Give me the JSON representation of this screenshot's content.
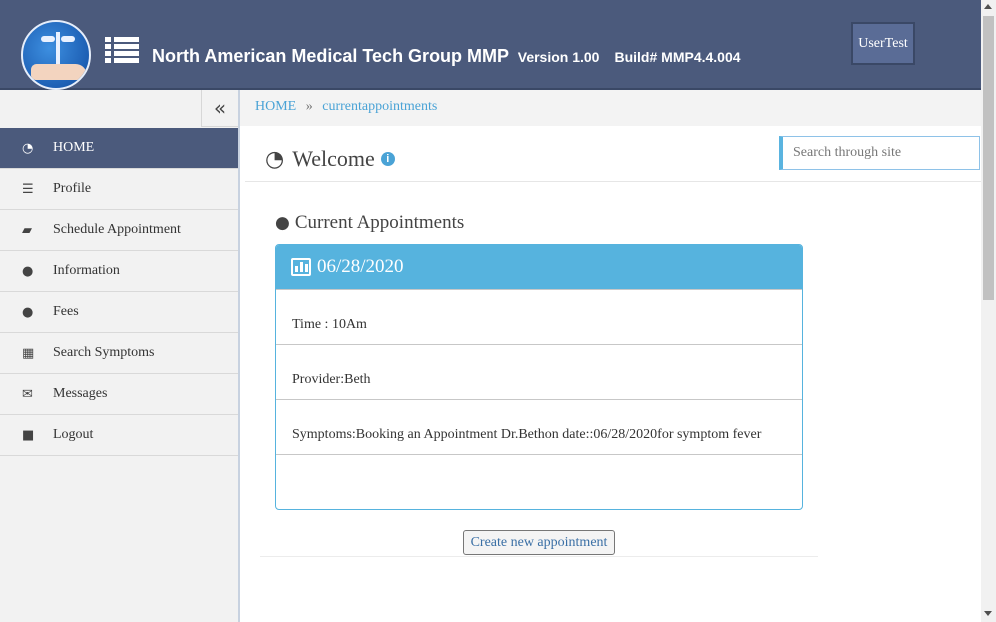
{
  "header": {
    "app_name": "North American Medical Tech Group MMP",
    "version": "Version 1.00",
    "build": "Build# MMP4.4.004",
    "user": "UserTest"
  },
  "sidebar": {
    "collapse_icon": "double-chevron-left-icon",
    "items": [
      {
        "label": "HOME",
        "icon": "dashboard-icon",
        "active": true
      },
      {
        "label": "Profile",
        "icon": "list-indent-icon"
      },
      {
        "label": "Schedule Appointment",
        "icon": "book-icon"
      },
      {
        "label": "Information",
        "icon": "drop-icon"
      },
      {
        "label": "Fees",
        "icon": "user-icon"
      },
      {
        "label": "Search Symptoms",
        "icon": "table-icon"
      },
      {
        "label": "Messages",
        "icon": "envelope-icon"
      },
      {
        "label": "Logout",
        "icon": "lock-icon"
      }
    ]
  },
  "breadcrumb": {
    "home": "HOME",
    "separator": "»",
    "current": "currentappointments"
  },
  "page": {
    "title": "Welcome",
    "search_placeholder": "Search through site"
  },
  "appointments": {
    "section_title": "Current Appointments",
    "card": {
      "date": "06/28/2020",
      "time": "Time : 10Am",
      "provider": "Provider:Beth",
      "symptoms": "Symptoms:Booking an Appointment Dr.Bethon date::06/28/2020for symptom fever"
    },
    "create_button": "Create new appointment"
  },
  "colors": {
    "header_bg": "#4b5a7c",
    "accent": "#56b3de",
    "link": "#4aa3d6"
  }
}
